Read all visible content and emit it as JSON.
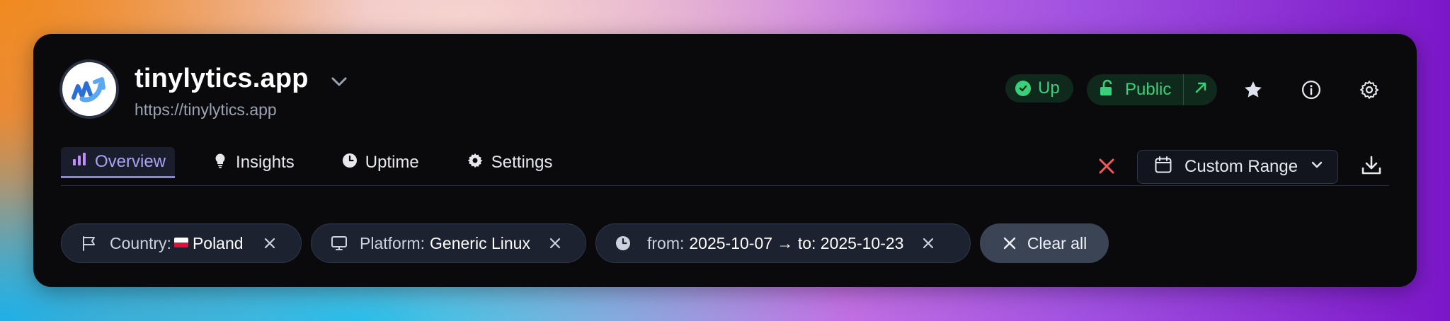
{
  "site": {
    "name": "tinylytics.app",
    "url": "https://tinylytics.app"
  },
  "status": {
    "up_label": "Up",
    "public_label": "Public"
  },
  "tabs": [
    {
      "label": "Overview",
      "icon": "bar-chart-icon",
      "active": true
    },
    {
      "label": "Insights",
      "icon": "lightbulb-icon",
      "active": false
    },
    {
      "label": "Uptime",
      "icon": "clock-icon",
      "active": false
    },
    {
      "label": "Settings",
      "icon": "gear-icon",
      "active": false
    }
  ],
  "range": {
    "label": "Custom Range"
  },
  "filters": [
    {
      "key": "Country:",
      "value": "Poland",
      "icon": "flag-outline-icon"
    },
    {
      "key": "Platform:",
      "value": "Generic Linux",
      "icon": "monitor-icon"
    },
    {
      "key": "from:",
      "value": "2025-10-07 → to: 2025-10-23",
      "icon": "clock-icon"
    }
  ],
  "clear_all_label": "Clear all",
  "colors": {
    "accent": "#8b80f0",
    "status_green": "#3ad07a",
    "danger": "#f05a5a",
    "card_bg": "#0a0a0c"
  }
}
